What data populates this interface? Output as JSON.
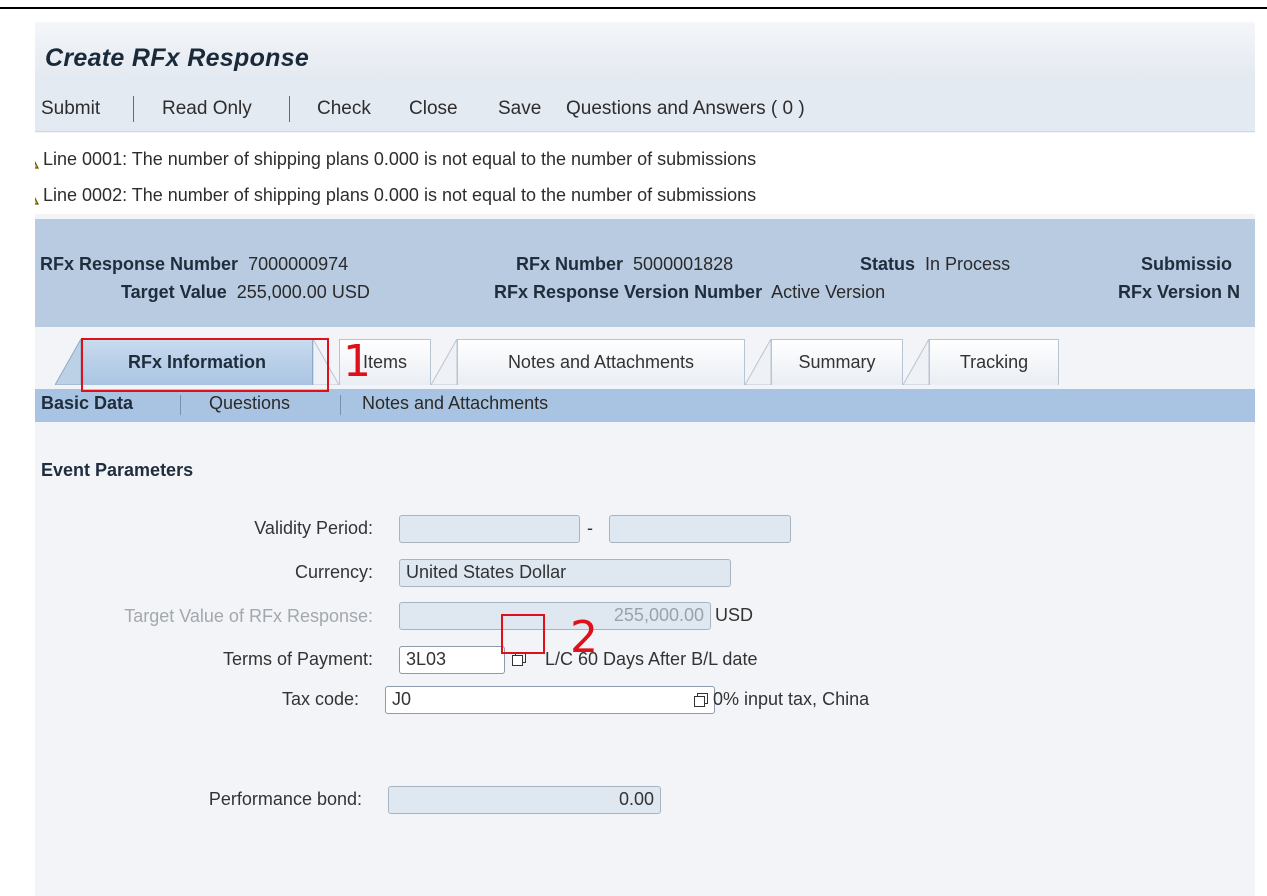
{
  "page": {
    "title": "Create RFx Response"
  },
  "toolbar": {
    "submit": "Submit",
    "read_only": "Read Only",
    "check": "Check",
    "close": "Close",
    "save": "Save",
    "qa": "Questions and Answers ( 0 )"
  },
  "messages": [
    {
      "icon": "warning-icon",
      "text": "Line 0001: The number of shipping plans 0.000 is not equal to the number of submissions"
    },
    {
      "icon": "warning-icon",
      "text": "Line 0002: The number of shipping plans 0.000 is not equal to the number of submissions"
    }
  ],
  "header": {
    "response_number_label": "RFx Response Number",
    "response_number": "7000000974",
    "rfx_number_label": "RFx Number",
    "rfx_number": "5000001828",
    "status_label": "Status",
    "status": "In Process",
    "submission_label": "Submissio",
    "target_value_label": "Target Value",
    "target_value": "255,000.00 USD",
    "version_number_label": "RFx Response Version Number",
    "version_number": "Active Version",
    "rfx_version_label": "RFx Version N"
  },
  "tabs": [
    {
      "label": "RFx Information",
      "active": true
    },
    {
      "label": "Items",
      "active": false
    },
    {
      "label": "Notes and Attachments",
      "active": false
    },
    {
      "label": "Summary",
      "active": false
    },
    {
      "label": "Tracking",
      "active": false
    }
  ],
  "subtabs": [
    {
      "label": "Basic Data",
      "active": true
    },
    {
      "label": "Questions",
      "active": false
    },
    {
      "label": "Notes and Attachments",
      "active": false
    }
  ],
  "form": {
    "section_title": "Event Parameters",
    "validity_label": "Validity Period:",
    "validity_from": "",
    "validity_sep": "-",
    "validity_to": "",
    "currency_label": "Currency:",
    "currency_value": "United States Dollar",
    "target_label": "Target Value of RFx Response:",
    "target_value": "255,000.00",
    "target_unit": "USD",
    "terms_label": "Terms of Payment:",
    "terms_value": "3L03",
    "terms_desc": "L/C 60 Days After B/L date",
    "tax_label": "Tax code:",
    "tax_value": "J0",
    "tax_desc": "0% input tax, China",
    "bond_label": "Performance bond:",
    "bond_value": "0.00"
  },
  "annotations": {
    "one": "1",
    "two": "2"
  },
  "colors": {
    "accent": "#a9c4e2",
    "header_bg": "#b9cbe0",
    "highlight": "#e0101a"
  }
}
